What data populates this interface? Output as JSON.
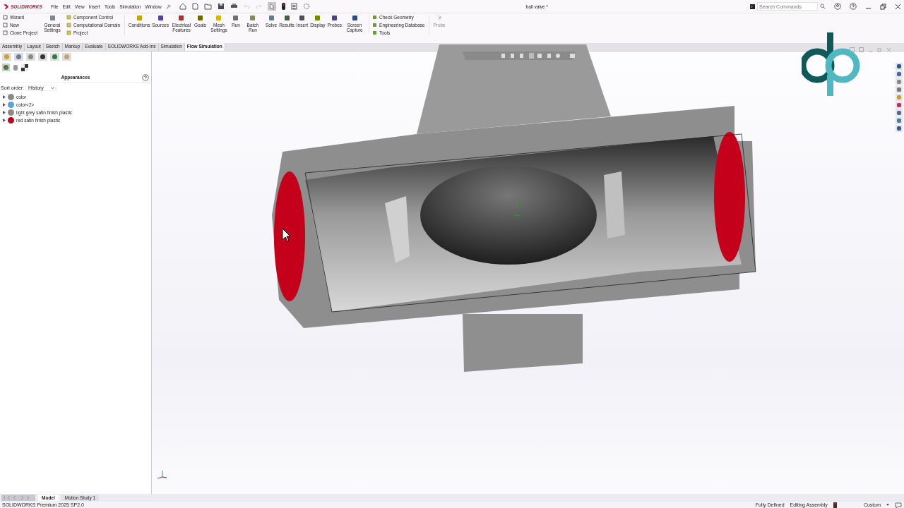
{
  "app": {
    "logo_text": "SOLIDWORKS",
    "menu": [
      "File",
      "Edit",
      "View",
      "Insert",
      "Tools",
      "Simulation",
      "Window"
    ],
    "document_title": "ball valve *",
    "search": {
      "placeholder": "Search Commands"
    }
  },
  "ribbon": {
    "project_commands": [
      "Wizard",
      "New",
      "Clone Project"
    ],
    "general_settings": "General Settings",
    "setup_commands": [
      "Component Control",
      "Computational Domain",
      "Project"
    ],
    "buttons": [
      {
        "label": "Conditions",
        "color": "#c9a400"
      },
      {
        "label": "Sources",
        "color": "#5a3ea8"
      },
      {
        "label": "Electrical Features",
        "color": "#b03030"
      },
      {
        "label": "Goals",
        "color": "#6b6b00"
      },
      {
        "label": "Mesh Settings",
        "color": "#d8b800"
      },
      {
        "label": "Run",
        "color": "#707070"
      },
      {
        "label": "Batch Run",
        "color": "#8a8a60"
      },
      {
        "label": "Solve",
        "color": "#5a7aa0"
      },
      {
        "label": "Results",
        "color": "#406040"
      },
      {
        "label": "Insert",
        "color": "#505050"
      },
      {
        "label": "Display",
        "color": "#6f8f00"
      },
      {
        "label": "Probes",
        "color": "#504080"
      },
      {
        "label": "Screen Capture",
        "color": "#1f4f8f"
      }
    ],
    "tool_commands": [
      "Check Geometry",
      "Engineering Database",
      "Tools"
    ],
    "probe": {
      "label": "Probe",
      "disabled": true
    }
  },
  "tabs": [
    {
      "label": "Assembly",
      "selected": false
    },
    {
      "label": "Layout",
      "selected": false
    },
    {
      "label": "Sketch",
      "selected": false
    },
    {
      "label": "Markup",
      "selected": false
    },
    {
      "label": "Evaluate",
      "selected": false
    },
    {
      "label": "SOLIDWORKS Add-Ins",
      "selected": false
    },
    {
      "label": "Simulation",
      "selected": false
    },
    {
      "label": "Flow Simulation",
      "selected": true
    }
  ],
  "panel": {
    "title": "Appearances",
    "sort_label": "Sort order:",
    "sort_value": "History",
    "items": [
      {
        "label": "color",
        "color": "#8a8a8a"
      },
      {
        "label": "color<2>",
        "color": "#5aa0e0"
      },
      {
        "label": "light grey satin finish plastic",
        "color": "#8a8a8a"
      },
      {
        "label": "red satin finish plastic",
        "color": "#c00018"
      }
    ]
  },
  "bottom_tabs": [
    {
      "label": "Model",
      "selected": true
    },
    {
      "label": "Motion Study 1",
      "selected": false
    }
  ],
  "status_bar": {
    "product": "SOLIDWORKS Premium 2025 SP2.0",
    "fully_defined": "Fully Defined",
    "mode": "Editing Assembly",
    "units": "Custom"
  }
}
